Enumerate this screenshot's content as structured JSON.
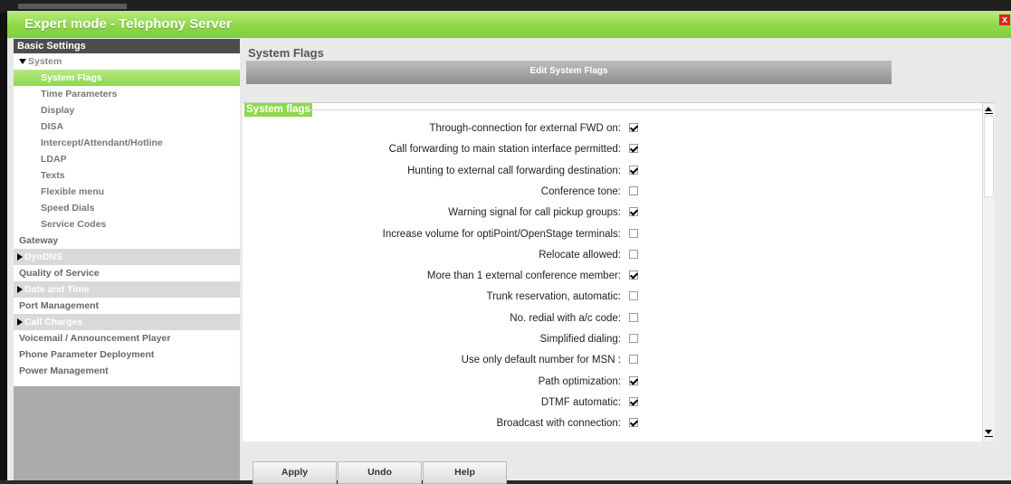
{
  "window": {
    "title": "Expert mode - Telephony Server",
    "close_label": "x"
  },
  "sidebar": {
    "header": "Basic Settings",
    "system_label": "System",
    "system_items": [
      "System Flags",
      "Time Parameters",
      "Display",
      "DISA",
      "Intercept/Attendant/Hotline",
      "LDAP",
      "Texts",
      "Flexible menu",
      "Speed Dials",
      "Service Codes"
    ],
    "active_item": "System Flags",
    "gateway": "Gateway",
    "dyndns": "DynDNS",
    "qos": "Quality of Service",
    "date_time": "Date and Time",
    "port_mgmt": "Port Management",
    "call_charges": "Call Charges",
    "voicemail": "Voicemail / Announcement Player",
    "phone_param": "Phone Parameter Deployment",
    "power_mgmt": "Power Management"
  },
  "main": {
    "section_title": "System Flags",
    "tab_label": "Edit System Flags",
    "legend": "System flags",
    "flags": [
      {
        "label": "Through-connection for external FWD on:",
        "checked": true
      },
      {
        "label": "Call forwarding to main station interface permitted:",
        "checked": true
      },
      {
        "label": "Hunting to external call forwarding destination:",
        "checked": true
      },
      {
        "label": "Conference tone:",
        "checked": false
      },
      {
        "label": "Warning signal for call pickup groups:",
        "checked": true
      },
      {
        "label": "Increase volume for optiPoint/OpenStage terminals:",
        "checked": false
      },
      {
        "label": "Relocate allowed:",
        "checked": false
      },
      {
        "label": "More than 1 external conference member:",
        "checked": true
      },
      {
        "label": "Trunk reservation, automatic:",
        "checked": false
      },
      {
        "label": "No. redial with a/c code:",
        "checked": false
      },
      {
        "label": "Simplified dialing:",
        "checked": false
      },
      {
        "label": "Use only default number for MSN :",
        "checked": false
      },
      {
        "label": "Path optimization:",
        "checked": true
      },
      {
        "label": "DTMF automatic:",
        "checked": true
      },
      {
        "label": "Broadcast with connection:",
        "checked": true
      }
    ]
  },
  "buttons": {
    "apply": "Apply",
    "undo": "Undo",
    "help": "Help"
  },
  "colors": {
    "accent_green": "#8fd84a",
    "sidebar_header": "#4d4d4d",
    "close_red": "#e02020"
  }
}
